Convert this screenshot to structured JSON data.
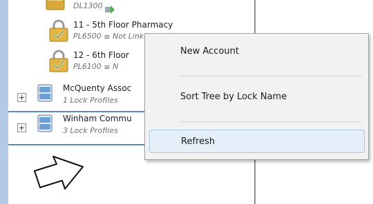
{
  "tree": {
    "items": [
      {
        "line1": "",
        "line2": "DL1300"
      },
      {
        "line1": "11 - 5th Floor Pharmacy",
        "line2": "PL6500",
        "status": "Not Linked"
      },
      {
        "line1": "12 - 6th Floor",
        "line2": "PL6100",
        "status": "N"
      },
      {
        "line1": "McQuenty Assoc",
        "line2": "1 Lock Profiles"
      },
      {
        "line1": "Winham Commu",
        "line2": "3 Lock Profiles"
      }
    ]
  },
  "context_menu": {
    "items": [
      {
        "label": "New Account"
      },
      {
        "label": "Sort Tree by Lock Name"
      },
      {
        "label": "Refresh"
      }
    ]
  },
  "colors": {
    "accent": "#5d88b8",
    "menu_highlight": "#e4eff9",
    "rail": "#b4c9e6"
  },
  "icons": [
    "lock-icon",
    "wifi-icon",
    "expand-icon",
    "cabinet-icon",
    "pointer-arrow-icon"
  ]
}
